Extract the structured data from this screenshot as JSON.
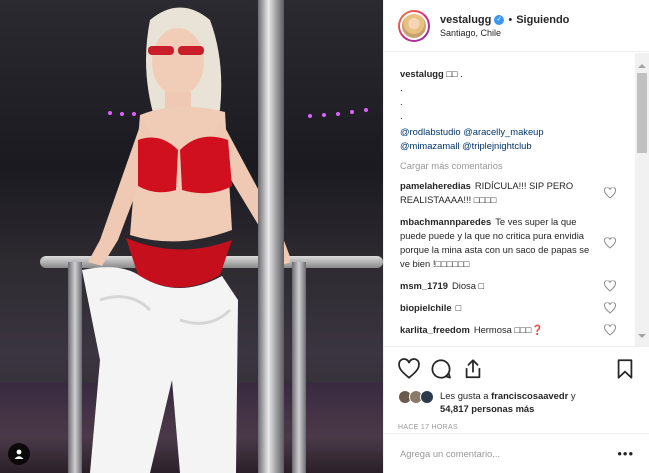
{
  "post": {
    "username": "vestalugg",
    "follow_status": "Siguiendo",
    "separator": "•",
    "location": "Santiago, Chile",
    "caption": {
      "username": "vestalugg",
      "text": "□□ .",
      "dots": [
        ".",
        ".",
        "."
      ],
      "mentions": [
        "@rodlabstudio",
        "@aracelly_makeup",
        "@mimazamall",
        "@triplejnightclub"
      ]
    },
    "load_more": "Cargar más comentarios",
    "comments": [
      {
        "user": "pamelaheredias",
        "text": "RIDÍCULA!!! SIP PERO REALISTAAAA!!! □□□□"
      },
      {
        "user": "mbachmannparedes",
        "text": "Te ves super la que puede puede y la que no critica pura envidia porque la mina asta con un saco de papas se ve bien !□□□□□□"
      },
      {
        "user": "msm_1719",
        "text": "Diosa □"
      },
      {
        "user": "biopielchile",
        "text": "□"
      },
      {
        "user": "karlita_freedom",
        "text": "Hermosa □□□❓"
      }
    ],
    "likes": {
      "prefix": "Les gusta a",
      "user": "franciscosaavedr",
      "connector": "y",
      "count": "54,817 personas más"
    },
    "timestamp": "HACE 17 HORAS",
    "comment_placeholder": "Agrega un comentario...",
    "more_options": "•••"
  },
  "colors": {
    "link": "#003569",
    "verified": "#3897f0",
    "muted": "#999999",
    "border": "#efefef"
  },
  "icons": [
    "verified-badge-icon",
    "heart-icon",
    "comment-icon",
    "share-icon",
    "bookmark-icon",
    "user-tag-icon",
    "scroll-up-arrow-icon",
    "scroll-down-arrow-icon"
  ]
}
